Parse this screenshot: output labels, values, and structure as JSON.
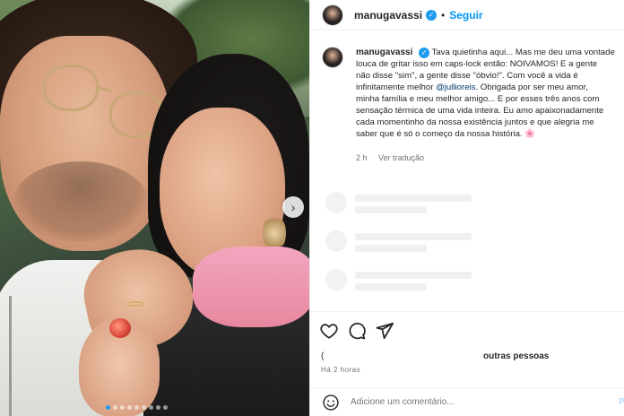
{
  "post": {
    "username": "manugavassi",
    "follow_label": "Seguir",
    "separator": "•",
    "caption_lines": [
      "Tava quietinha aqui... Mas me deu uma vontade",
      "louca de gritar isso em caps-lock então: NOIVAMOS! E a gente",
      "não disse \"sim\", a gente disse \"óbvio!\". Com você a vida é",
      "infinitamente melhor ",
      ". Obrigada por ser meu amor,",
      "minha família e meu melhor amigo... E por esses três anos com",
      "sensação térmica de uma vida inteira. Eu amo apaixonadamente",
      "cada momentinho da nossa existência juntos e que alegria me",
      "saber que é só o começo da nossa história. 🌸"
    ],
    "mention": "@jullioreis",
    "time_ago": "2 h",
    "translate_label": "Ver tradução",
    "likes_prefix": "(",
    "likes_rest": "outras pessoas",
    "posted_time": "Há 2 horas",
    "comment_placeholder": "Adicione um comentário...",
    "publish_label": "Pu",
    "carousel_next": "›",
    "carousel_dots": 9,
    "carousel_active_index": 0
  },
  "icons": {
    "verified": "verified-badge-icon",
    "like": "heart-icon",
    "comment": "comment-icon",
    "share": "share-icon",
    "emoji": "emoji-icon"
  },
  "colors": {
    "accent": "#0095f6",
    "verified": "#1f9bf0",
    "text": "#262626",
    "secondary": "#737373"
  }
}
